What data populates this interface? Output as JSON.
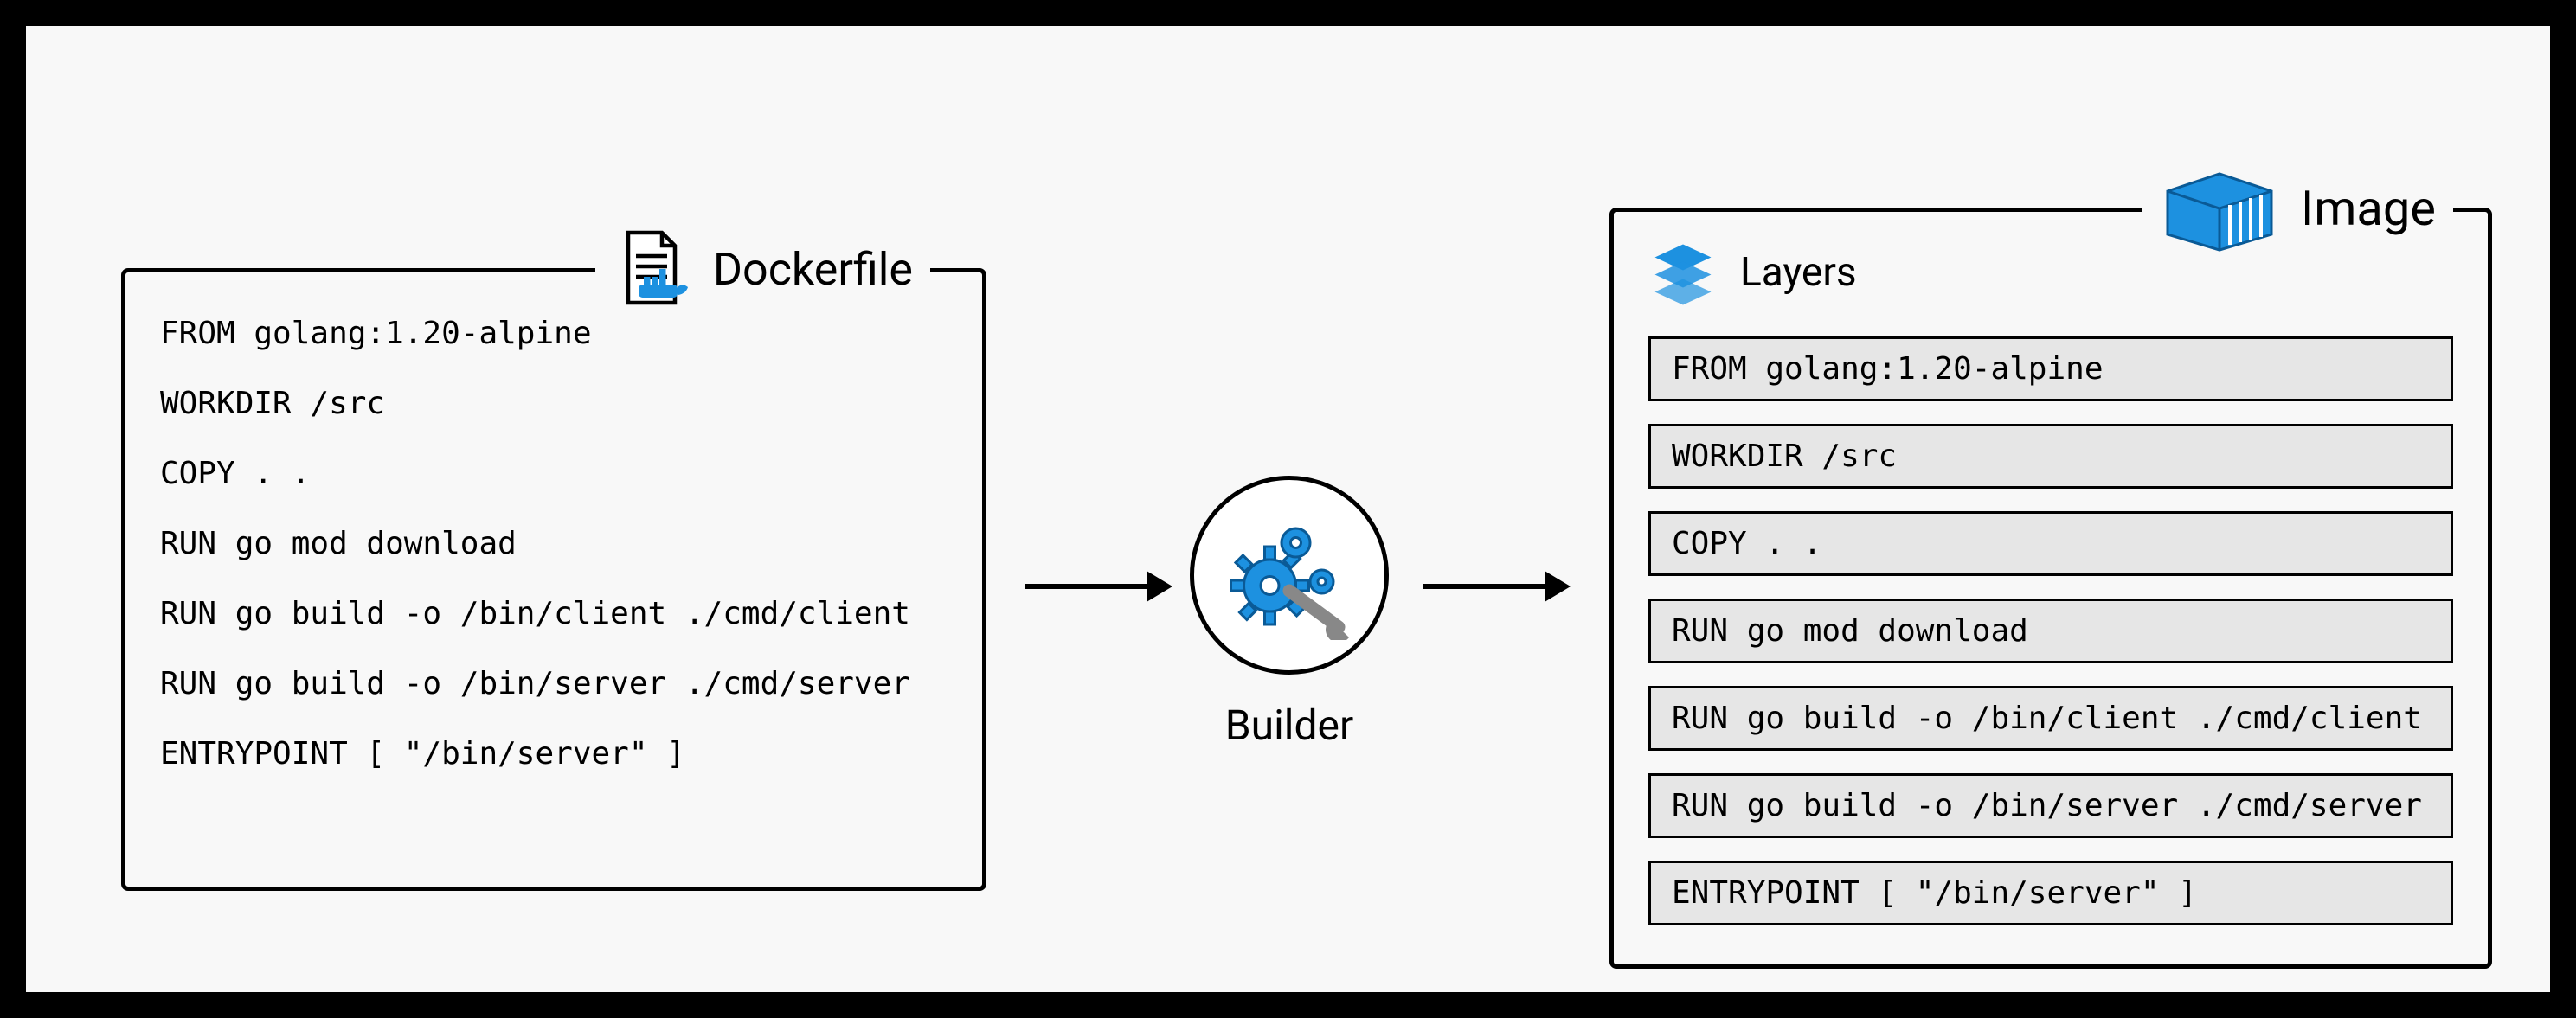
{
  "dockerfile": {
    "title": "Dockerfile",
    "lines": [
      "FROM golang:1.20-alpine",
      "WORKDIR /src",
      "COPY . .",
      "RUN go mod download",
      "RUN go build -o /bin/client ./cmd/client",
      "RUN go build -o /bin/server ./cmd/server",
      "ENTRYPOINT [ \"/bin/server\" ]"
    ]
  },
  "builder": {
    "label": "Builder"
  },
  "image": {
    "title": "Image",
    "layers_label": "Layers",
    "layers": [
      "FROM golang:1.20-alpine",
      "WORKDIR /src",
      "COPY . .",
      "RUN go mod download",
      "RUN go build -o /bin/client ./cmd/client",
      "RUN go build -o /bin/server ./cmd/server",
      "ENTRYPOINT [ \"/bin/server\" ]"
    ]
  },
  "colors": {
    "accent": "#1d91e0",
    "panel_bg": "#f8f8f8",
    "layer_bg": "#e6e6e6"
  }
}
